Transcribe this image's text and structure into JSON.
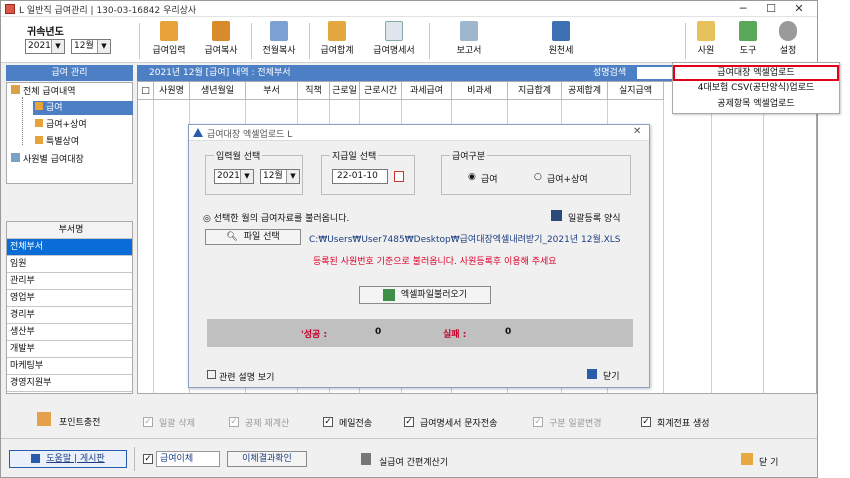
{
  "window": {
    "title": "L 일반직 급여관리 | 130-03-16842  우리상사",
    "minimize": "─",
    "maximize": "☐",
    "close": "✕"
  },
  "period": {
    "label": "귀속년도",
    "year": "2021",
    "month": "12월"
  },
  "toolbar": {
    "pay_input": "급여입력",
    "pay_copy": "급여복사",
    "prev_copy": "전월복사",
    "pay_total": "급여합계",
    "payslip": "급여명세서",
    "report": "보고서",
    "withholding": "원천세",
    "employee": "사원",
    "tools": "도구",
    "settings": "설정"
  },
  "left": {
    "header": "급여 관리",
    "tree": {
      "all": "전체 급여내역",
      "salary": "급여",
      "salary_bonus": "급여+상여",
      "special_bonus": "특별상여",
      "by_employee": "사원별 급여대장"
    },
    "dept_header": "부서명",
    "depts": [
      "전체부서",
      "임원",
      "관리부",
      "영업부",
      "경리부",
      "생산부",
      "개발부",
      "마케팅부",
      "경영지원부"
    ]
  },
  "grid": {
    "caption": "2021년 12월 [급여] 내역 : 전체부서",
    "search_label": "성명검색",
    "columns": [
      "□",
      "사원명",
      "생년월일",
      "부서",
      "직책",
      "근로일",
      "근로시간",
      "과세급여",
      "비과세",
      "지급합계",
      "공제합계",
      "실지급액"
    ]
  },
  "menu": {
    "items": [
      "급여대장 엑셀업로드",
      "4대보험 CSV(공단양식)업로드",
      "공제항목 엑셀업로드"
    ]
  },
  "dialog": {
    "title": "급여대장 엑셀업로드 L",
    "month_group": "입력월 선택",
    "year": "2021",
    "month": "12월",
    "payday_group": "지급일 선택",
    "payday": "22-01-10",
    "type_group": "급여구분",
    "type_salary": "급여",
    "type_salary_bonus": "급여+상여",
    "load_note": "◎ 선택한 월의 급여자료를 불러옵니다.",
    "bulk_form": "일괄등록 양식",
    "file_button": "파일 선택",
    "file_path": "C:₩Users₩User7485₩Desktop₩급여대장엑셀내려받기_2021년 12월.XLS",
    "warning": "등록된 사원번호 기준으로 불러옵니다. 사원등록후 이용해 주세요",
    "load_button": "엑셀파일불러오기",
    "success_label": "'성공 :",
    "success_value": "0",
    "fail_label": "실패 :",
    "fail_value": "0",
    "help_link": "관련 설명 보기",
    "close": "닫기"
  },
  "options": {
    "point_charge": "포인트충전",
    "bulk_delete": "일괄 삭제",
    "recalc_deduction": "공제 재계산",
    "send_mail": "메일전송",
    "send_sms": "급여명세서 문자전송",
    "bulk_change": "구분 일괄변경",
    "accounting_slip": "회계전표 생성"
  },
  "footer": {
    "help_board": "도움말 | 게시판",
    "pay_transfer": "급여이체",
    "transfer_result": "이체결과확인",
    "calc_label": "실급여 간편계산기",
    "close": "닫 기"
  },
  "colors": {
    "accent": "#4d7fc4",
    "selected": "#0a6cd6",
    "warning_red": "#e0002a",
    "menu_highlight_border": "#e0001a"
  }
}
